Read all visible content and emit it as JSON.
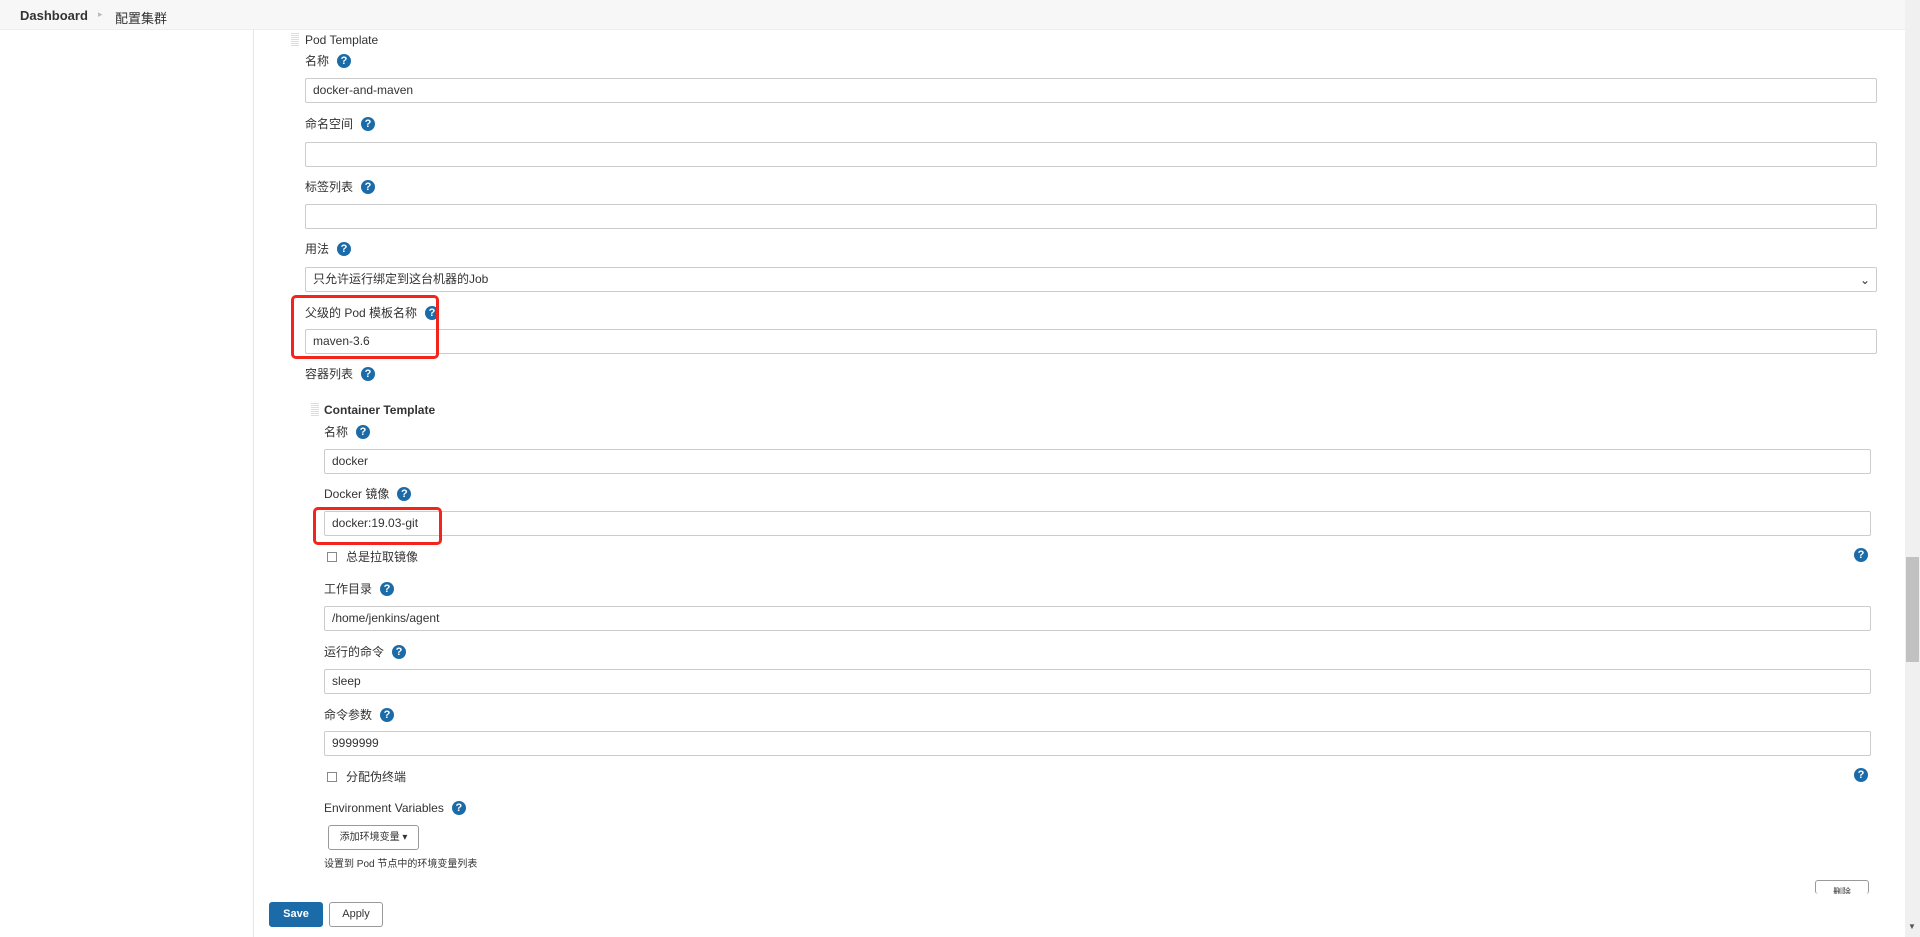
{
  "breadcrumb": [
    "Dashboard",
    "配置集群"
  ],
  "pod_template": {
    "title": "Pod Template",
    "name_label": "名称",
    "name_value": "docker-and-maven",
    "namespace_label": "命名空间",
    "namespace_value": "",
    "labels_label": "标签列表",
    "labels_value": "",
    "usage_label": "用法",
    "usage_value": "只允许运行绑定到这台机器的Job",
    "parent_label": "父级的 Pod 模板名称",
    "parent_value": "maven-3.6",
    "containers_label": "容器列表"
  },
  "container_template": {
    "title": "Container Template",
    "name_label": "名称",
    "name_value": "docker",
    "image_label": "Docker 镜像",
    "image_value": "docker:19.03-git",
    "always_pull_label": "总是拉取镜像",
    "workdir_label": "工作目录",
    "workdir_value": "/home/jenkins/agent",
    "command_label": "运行的命令",
    "command_value": "sleep",
    "args_label": "命令参数",
    "args_value": "9999999",
    "tty_label": "分配伪终端",
    "env_label": "Environment Variables",
    "add_env_label": "添加环境变量",
    "env_desc": "设置到 Pod 节点中的环境变量列表",
    "delete_label": "删除"
  },
  "footer": {
    "save": "Save",
    "apply": "Apply"
  },
  "help_glyph": "?",
  "colors": {
    "primary": "#1b6ba8",
    "highlight": "#f2241b"
  }
}
